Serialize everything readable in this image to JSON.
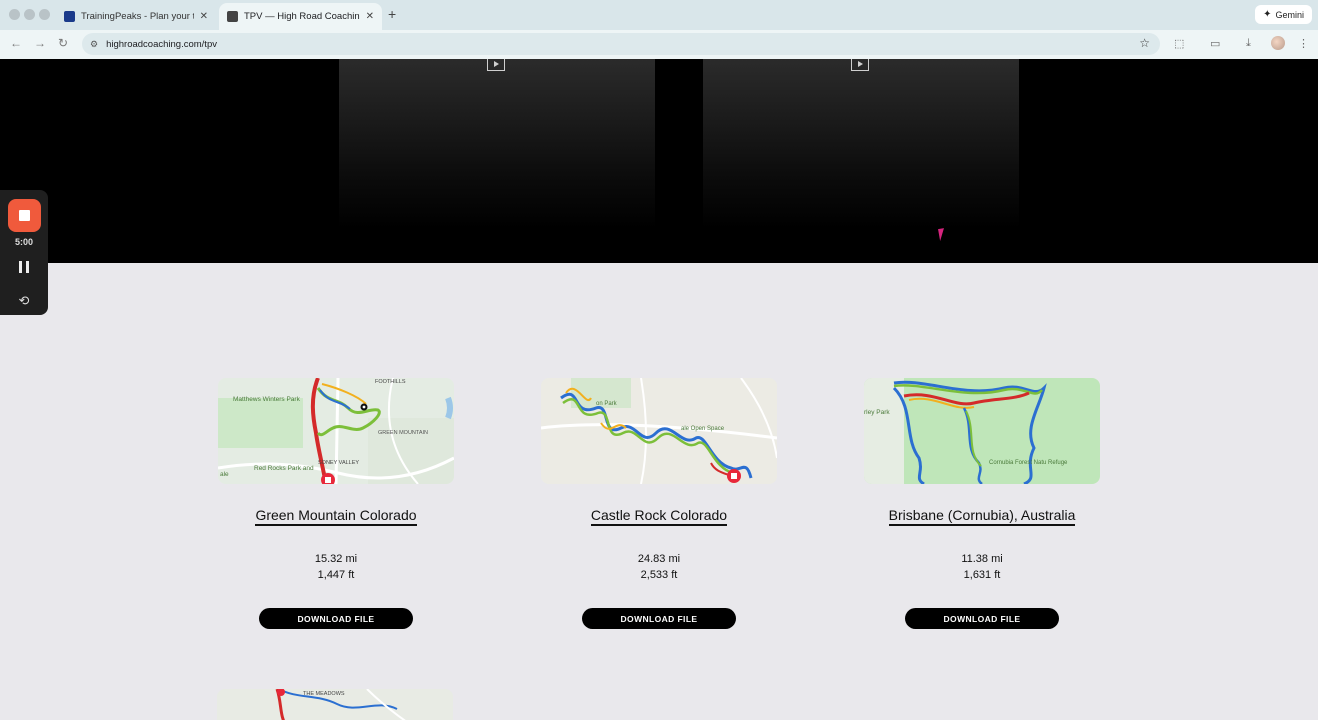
{
  "browser": {
    "tabs": [
      {
        "title": "TrainingPeaks - Plan your tra",
        "active": false,
        "favicon_color": "#1a3a8a"
      },
      {
        "title": "TPV — High Road Coaching",
        "active": true,
        "favicon_color": "#444"
      }
    ],
    "gemini_label": "Gemini",
    "url": "highroadcoaching.com/tpv"
  },
  "recorder": {
    "time": "5:00"
  },
  "routes": [
    {
      "title": "Green Mountain Colorado",
      "distance": "15.32 mi",
      "elevation": "1,447 ft",
      "button": "DOWNLOAD FILE",
      "map_labels": [
        "FOOTHILLS",
        "Matthews Winters Park",
        "GREEN MOUNTAIN",
        "Red Rocks Park and",
        "SONEY VALLEY",
        "ale"
      ]
    },
    {
      "title": "Castle Rock Colorado",
      "distance": "24.83 mi",
      "elevation": "2,533 ft",
      "button": "DOWNLOAD FILE",
      "map_labels": [
        "on Park",
        "ale Open Space"
      ]
    },
    {
      "title": "Brisbane (Cornubia), Australia",
      "distance": "11.38 mi",
      "elevation": "1,631 ft",
      "button": "DOWNLOAD FILE",
      "map_labels": [
        "rley Park",
        "Cornubia Forest Natu Refuge"
      ]
    }
  ],
  "partial_card": {
    "map_labels": [
      "THE MEADOWS"
    ]
  },
  "colors": {
    "hero_bg": "#000000",
    "page_bg": "#e9e8ec",
    "button_bg": "#000000",
    "record_red": "#f05a3c"
  }
}
